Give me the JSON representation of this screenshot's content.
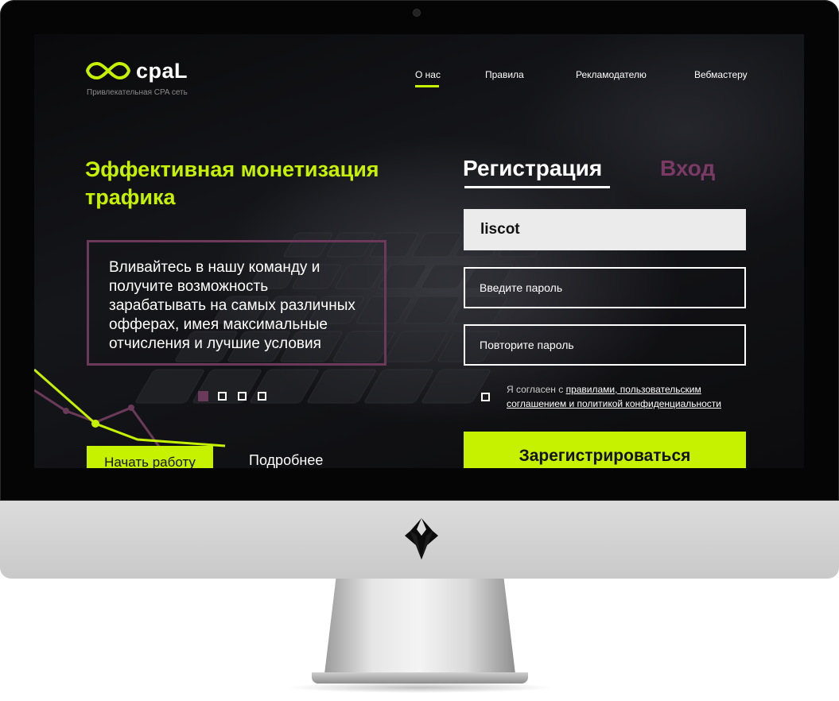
{
  "brand": {
    "name": "cpaL",
    "tagline": "Привлекательная CPA сеть",
    "accent": "#c6f200",
    "secondary": "#6b3a5a"
  },
  "nav": {
    "items": [
      {
        "label": "О нас",
        "active": true
      },
      {
        "label": "Правила",
        "active": false
      },
      {
        "label": "Рекламодателю",
        "active": false
      },
      {
        "label": "Вебмастеру",
        "active": false
      }
    ]
  },
  "hero": {
    "title": "Эффективная монетизация трафика",
    "text": "Вливайтесь в нашу команду и получите возможность зарабатывать на самых различных офферах, имея максимальные отчисления и лучшие условия",
    "slider": {
      "count": 4,
      "active_index": 0
    },
    "start_button": "Начать работу",
    "more_link": "Подробнее"
  },
  "form": {
    "tab_register": "Регистрация",
    "tab_login": "Вход",
    "username_value": "liscot",
    "password_placeholder": "Введите пароль",
    "password_repeat_placeholder": "Повторите пароль",
    "agree_prefix": "Я согласен с",
    "agree_link": "правилами, пользовательским соглашением и политикой конфиденциальности",
    "agree_checked": false,
    "submit": "Зарегистрироваться"
  },
  "device": {
    "logo_icon": "brand-emblem-icon"
  }
}
